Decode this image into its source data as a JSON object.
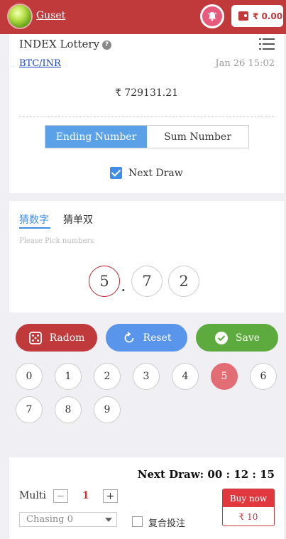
{
  "header": {
    "user": "Guset",
    "wallet_amount": "₹ 0.00"
  },
  "game": {
    "title": "INDEX Lottery",
    "help_glyph": "?",
    "pair": "BTC/INR",
    "time": "Jan 26 15:02",
    "price": "₹ 729131.21",
    "tabs": [
      "Ending Number",
      "Sum Number"
    ],
    "next_draw_label": "Next Draw",
    "next_draw_checked": true
  },
  "pick": {
    "tabs": [
      "猜数字",
      "猜单双"
    ],
    "hint": "Please Pick numbers",
    "digits": [
      "5",
      "7",
      "2"
    ],
    "separator": "."
  },
  "actions": {
    "random": "Radom",
    "reset": "Reset",
    "save": "Save"
  },
  "numbers": [
    "0",
    "1",
    "2",
    "3",
    "4",
    "5",
    "6",
    "7",
    "8",
    "9"
  ],
  "selected_number": "5",
  "bet": {
    "next_draw": "Next Draw: 00 : 12 : 15",
    "multi_label": "Multi",
    "minus": "−",
    "multi_value": "1",
    "plus": "+",
    "chasing": "Chasing 0",
    "combo_label": "复合投注",
    "buy_label": "Buy now",
    "buy_amount": "₹ 10"
  },
  "colors": {
    "brand": "#c0393b",
    "accent_blue": "#5aa1e8",
    "save_green": "#5dab3e",
    "selected": "#e26d74"
  },
  "icons": {
    "logo": "ball-logo-icon",
    "bell": "alarm-bell-icon",
    "wallet": "wallet-icon",
    "menu": "list-menu-icon",
    "random": "dice-icon",
    "reset": "refresh-icon",
    "save": "check-circle-icon"
  }
}
